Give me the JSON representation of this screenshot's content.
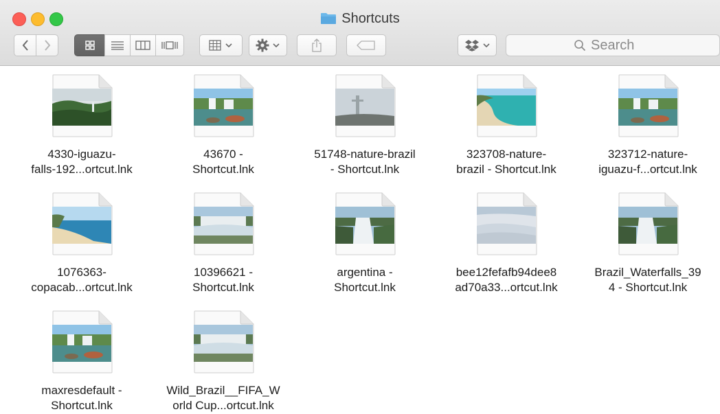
{
  "window": {
    "title": "Shortcuts",
    "title_icon": "folder-icon",
    "traffic_lights": {
      "close": "#fc5f57",
      "minimize": "#fdbc2e",
      "zoom": "#33c748"
    }
  },
  "toolbar": {
    "back_icon": "chevron-left-icon",
    "forward_icon": "chevron-right-icon",
    "view_modes": [
      "icon-view-icon",
      "list-view-icon",
      "column-view-icon",
      "cover-flow-icon"
    ],
    "selected_view": "icon-view-icon",
    "arrange_icon": "arrange-grid-icon",
    "action_icon": "gear-icon",
    "share_icon": "share-icon",
    "tag_icon": "tag-icon",
    "dropbox_icon": "dropbox-icon",
    "search_placeholder": "Search"
  },
  "files": [
    {
      "line1": "4330-iguazu-",
      "line2": "falls-192...ortcut.lnk",
      "scene": "jungle"
    },
    {
      "line1": "43670 -",
      "line2": "Shortcut.lnk",
      "scene": "falls"
    },
    {
      "line1": "51748-nature-brazil",
      "line2": "- Shortcut.lnk",
      "scene": "statue"
    },
    {
      "line1": "323708-nature-",
      "line2": "brazil - Shortcut.lnk",
      "scene": "beach"
    },
    {
      "line1": "323712-nature-",
      "line2": "iguazu-f...ortcut.lnk",
      "scene": "falls"
    },
    {
      "line1": "1076363-",
      "line2": "copacab...ortcut.lnk",
      "scene": "coast"
    },
    {
      "line1": "10396621 -",
      "line2": "Shortcut.lnk",
      "scene": "mist"
    },
    {
      "line1": "argentina -",
      "line2": "Shortcut.lnk",
      "scene": "gorge"
    },
    {
      "line1": "bee12fefafb94dee8",
      "line2": "ad70a33...ortcut.lnk",
      "scene": "dunes"
    },
    {
      "line1": "Brazil_Waterfalls_39",
      "line2": "4 - Shortcut.lnk",
      "scene": "gorge"
    },
    {
      "line1": "maxresdefault -",
      "line2": "Shortcut.lnk",
      "scene": "falls"
    },
    {
      "line1": "Wild_Brazil__FIFA_W",
      "line2": "orld Cup...ortcut.lnk",
      "scene": "mist"
    }
  ]
}
